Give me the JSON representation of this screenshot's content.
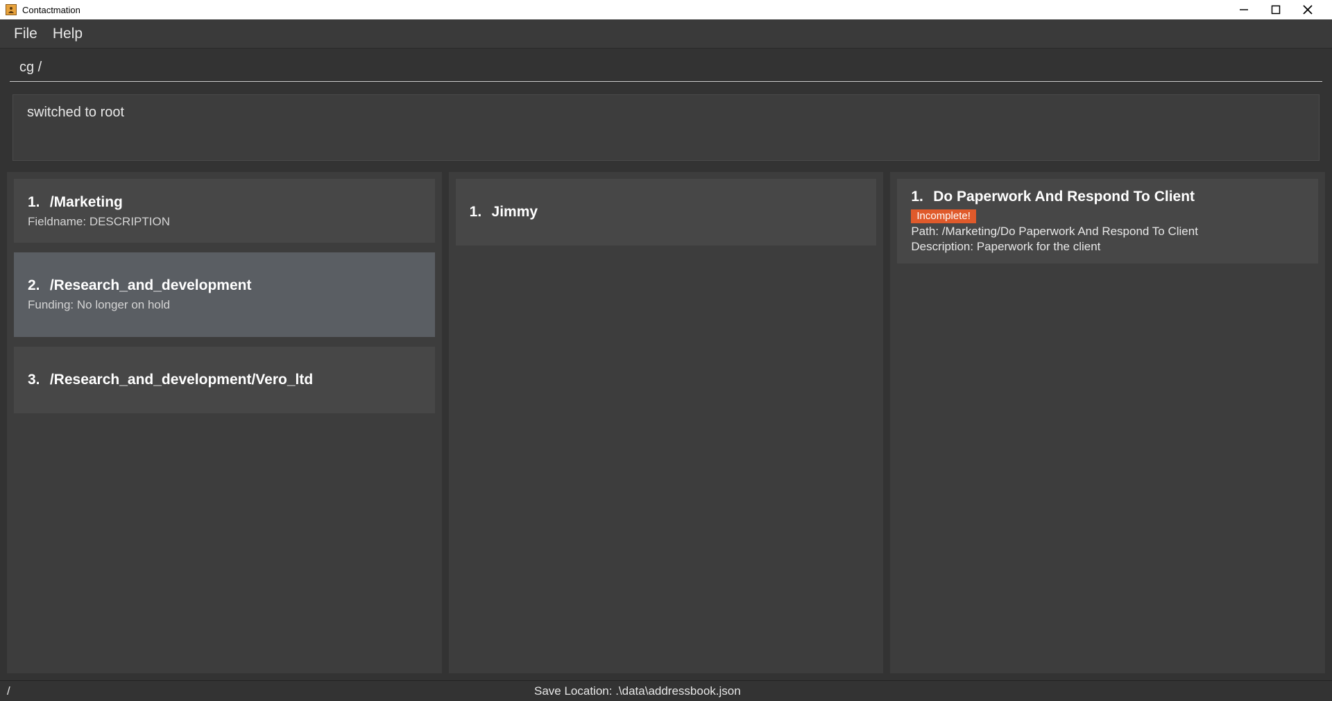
{
  "window": {
    "title": "Contactmation"
  },
  "menu": {
    "file": "File",
    "help": "Help"
  },
  "command": {
    "value": "cg /"
  },
  "status": {
    "message": "switched to root"
  },
  "columns": {
    "groups": [
      {
        "num": "1.",
        "title": "/Marketing",
        "subline": "Fieldname: DESCRIPTION",
        "selected": false
      },
      {
        "num": "2.",
        "title": "/Research_and_development",
        "subline": "Funding: No longer on hold",
        "selected": true
      },
      {
        "num": "3.",
        "title": "/Research_and_development/Vero_ltd",
        "subline": "",
        "selected": false
      }
    ],
    "people": [
      {
        "num": "1.",
        "title": "Jimmy"
      }
    ],
    "tasks": [
      {
        "num": "1.",
        "title": "Do Paperwork And Respond To Client",
        "badge": "Incomplete!",
        "path": "Path: /Marketing/Do Paperwork And Respond To Client",
        "desc": "Description: Paperwork for the client"
      }
    ]
  },
  "footer": {
    "path": "/",
    "save": "Save Location: .\\data\\addressbook.json"
  }
}
